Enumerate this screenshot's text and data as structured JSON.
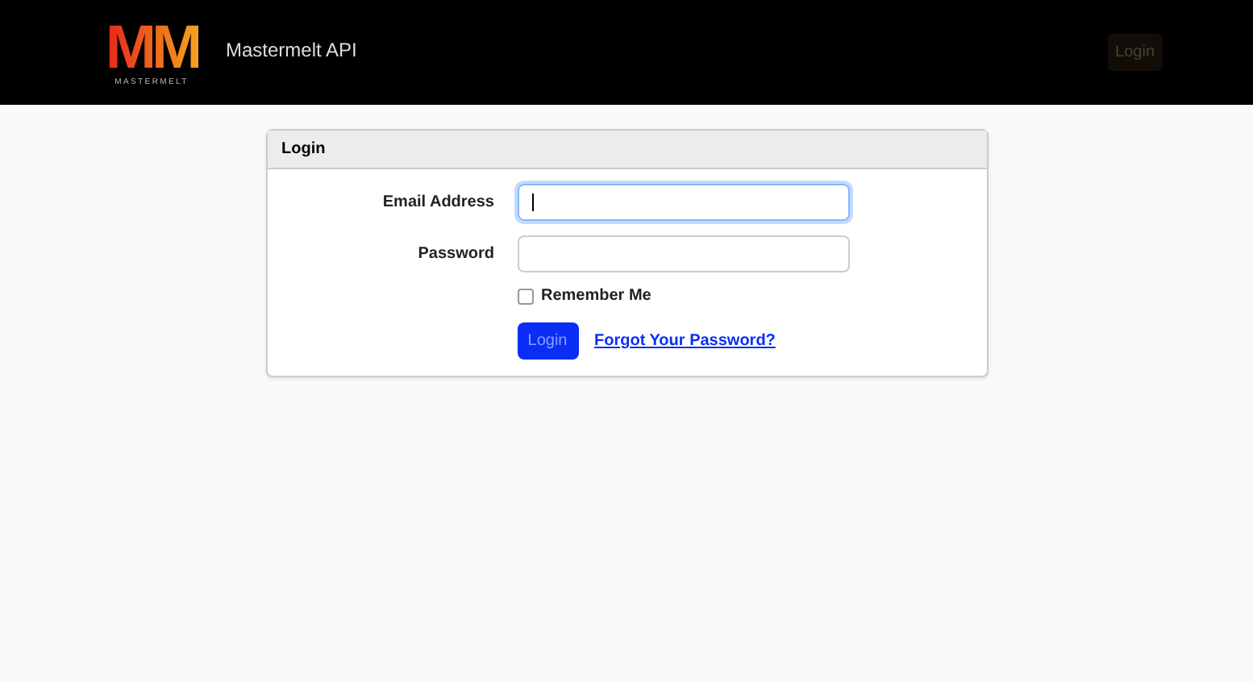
{
  "navbar": {
    "logo": {
      "mark": "MM",
      "wordmark": "MASTERMELT"
    },
    "brand": "Mastermelt API",
    "login_link": "Login"
  },
  "card": {
    "title": "Login",
    "fields": [
      {
        "label": "Email Address",
        "focused": true
      },
      {
        "label": "Password",
        "focused": false
      }
    ],
    "remember": {
      "label": "Remember Me",
      "checked": false
    },
    "submit": "Login",
    "forgot_link": "Forgot Your Password?"
  }
}
